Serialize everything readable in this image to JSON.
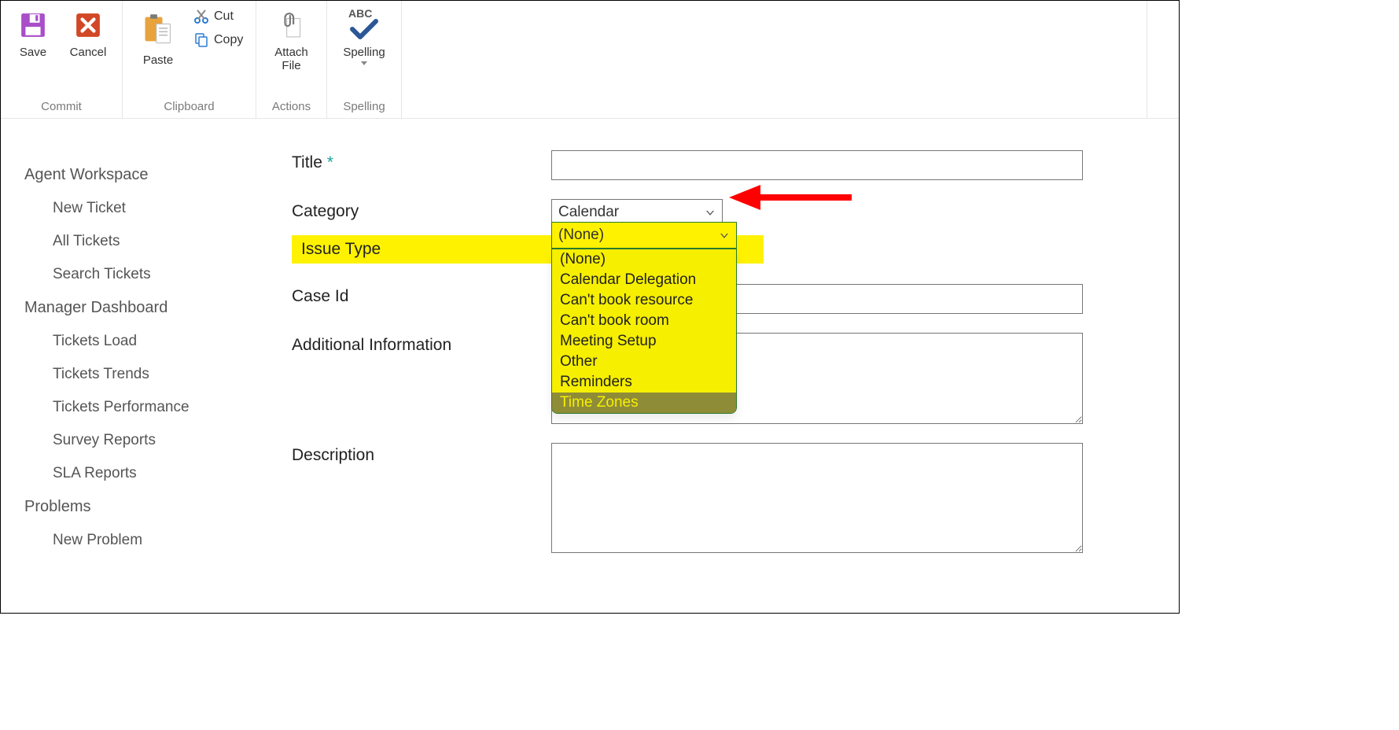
{
  "ribbon": {
    "commit": {
      "label_group": "Commit",
      "save": "Save",
      "cancel": "Cancel"
    },
    "clipboard": {
      "label_group": "Clipboard",
      "paste": "Paste",
      "cut": "Cut",
      "copy": "Copy"
    },
    "actions": {
      "label_group": "Actions",
      "attach_file_l1": "Attach",
      "attach_file_l2": "File"
    },
    "spelling": {
      "label_group": "Spelling",
      "spelling": "Spelling",
      "abc": "ABC"
    }
  },
  "sidebar": {
    "agent_workspace": "Agent Workspace",
    "new_ticket": "New Ticket",
    "all_tickets": "All Tickets",
    "search_tickets": "Search Tickets",
    "manager_dashboard": "Manager Dashboard",
    "tickets_load": "Tickets Load",
    "tickets_trends": "Tickets Trends",
    "tickets_performance": "Tickets Performance",
    "survey_reports": "Survey Reports",
    "sla_reports": "SLA Reports",
    "problems": "Problems",
    "new_problem": "New Problem"
  },
  "form": {
    "title_label": "Title",
    "category_label": "Category",
    "category_value": "Calendar",
    "issue_type_label": "Issue Type",
    "issue_type_value": "(None)",
    "issue_type_options": {
      "o0": "(None)",
      "o1": "Calendar Delegation",
      "o2": "Can't book resource",
      "o3": "Can't book room",
      "o4": "Meeting Setup",
      "o5": "Other",
      "o6": "Reminders",
      "o7": "Time Zones"
    },
    "issue_type_selected_index": 7,
    "caseid_label": "Case Id",
    "additional_label": "Additional Information",
    "description_label": "Description"
  }
}
